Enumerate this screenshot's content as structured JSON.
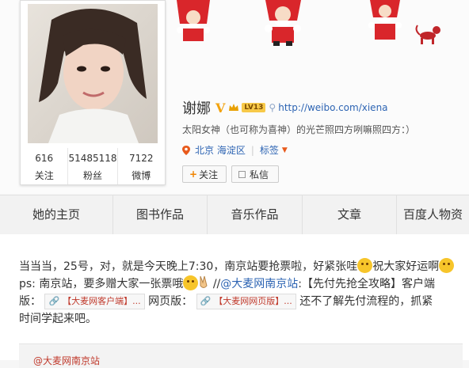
{
  "profile": {
    "name": "谢娜",
    "verified_mark": "V",
    "level": "LV13",
    "url": "http://weibo.com/xiena",
    "bio": "太阳女神（也可称为喜神）的光芒照四方咧嘛照四方：）",
    "location": "北京 海淀区",
    "tags_label": "标签"
  },
  "stats": [
    {
      "value": "616",
      "label": "关注"
    },
    {
      "value": "51485118",
      "label": "粉丝"
    },
    {
      "value": "7122",
      "label": "微博"
    }
  ],
  "actions": {
    "follow": "关注",
    "message": "私信"
  },
  "tabs": [
    "她的主页",
    "图书作品",
    "音乐作品",
    "文章",
    "百度人物资"
  ],
  "post": {
    "line1": "当当当，25号，对，就是今天晚上7:30，南京站要抢票啦，好紧张哇",
    "line1b": "祝大家好运啊",
    "line2a": "ps: 南京站，要多赠大家一张票哦",
    "line2b": "//",
    "mention": "@大麦网南京站",
    "line2c": ":【先付先抢全攻略】客户端",
    "line3a": "版：",
    "chip1": "【大麦网客户端】...",
    "line3b": "网页版：",
    "chip2": "【大麦网网页版】...",
    "line3c": "还不了解先付流程的，抓紧",
    "line4": "时间学起来吧。"
  },
  "repost_header": "@大麦网南京站"
}
